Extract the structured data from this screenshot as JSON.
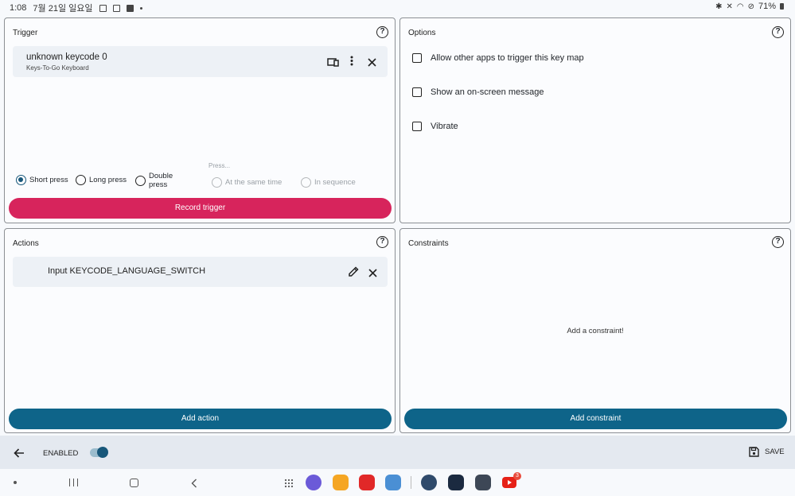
{
  "status": {
    "time": "1:08",
    "date": "7월 21일 일요일",
    "battery": "71%"
  },
  "trigger": {
    "title": "Trigger",
    "key_name": "unknown keycode 0",
    "key_device": "Keys-To-Go Keyboard",
    "press_label": "Press...",
    "options": [
      "Short press",
      "Long press",
      "Double press"
    ],
    "selected_option": "Short press",
    "sequence_options": [
      "At the same time",
      "In sequence"
    ],
    "record_button": "Record trigger"
  },
  "options": {
    "title": "Options",
    "items": [
      "Allow other apps to trigger this key map",
      "Show an on-screen message",
      "Vibrate"
    ]
  },
  "actions": {
    "title": "Actions",
    "item": "Input KEYCODE_LANGUAGE_SWITCH",
    "add_button": "Add action"
  },
  "constraints": {
    "title": "Constraints",
    "empty_text": "Add a constraint!",
    "add_button": "Add constraint"
  },
  "bottom_bar": {
    "enabled_label": "ENABLED",
    "enabled": true,
    "save_label": "SAVE"
  },
  "dock": {
    "youtube_badge": "3"
  },
  "colors": {
    "record": "#d7245c",
    "primary": "#0e6489",
    "toggle": "#17577a"
  }
}
